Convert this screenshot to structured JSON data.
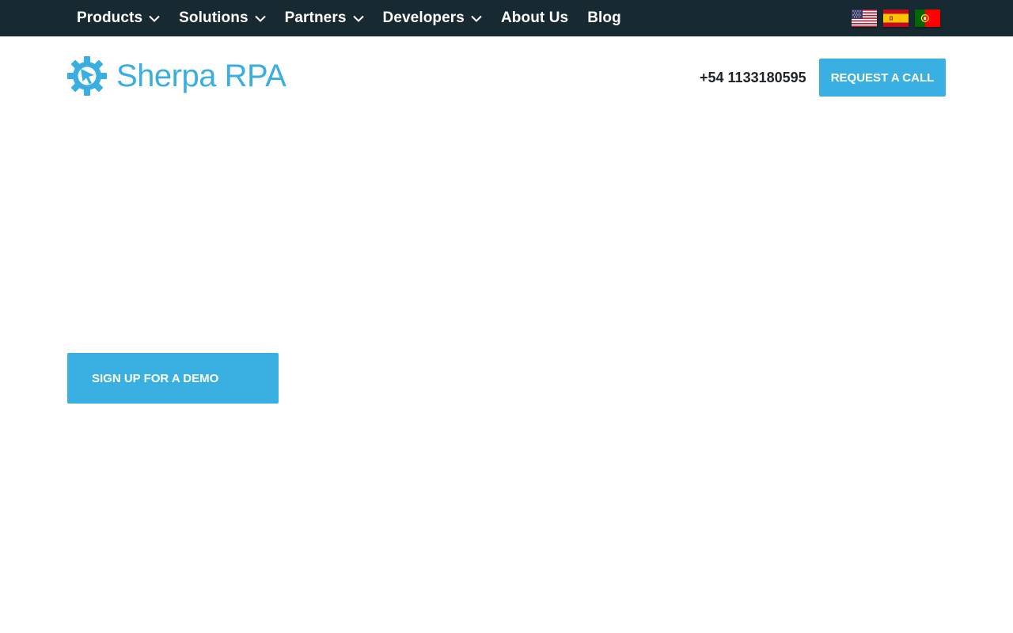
{
  "topnav": {
    "items": [
      {
        "label": "Products",
        "has_dropdown": true
      },
      {
        "label": "Solutions",
        "has_dropdown": true
      },
      {
        "label": "Partners",
        "has_dropdown": true
      },
      {
        "label": "Developers",
        "has_dropdown": true
      },
      {
        "label": "About Us",
        "has_dropdown": false
      },
      {
        "label": "Blog",
        "has_dropdown": false
      }
    ],
    "languages": [
      {
        "icon": "us-flag-icon"
      },
      {
        "icon": "spain-flag-icon"
      },
      {
        "icon": "portugal-flag-icon"
      }
    ]
  },
  "header": {
    "logo_text": "Sherpa RPA",
    "phone": "+54 1133180595",
    "cta_label": "REQUEST A CALL"
  },
  "hero": {
    "demo_label": "SIGN UP FOR A DEMO"
  },
  "colors": {
    "topbar": "#172931",
    "accent": "#3ab0e2",
    "text": "#1d2327"
  }
}
